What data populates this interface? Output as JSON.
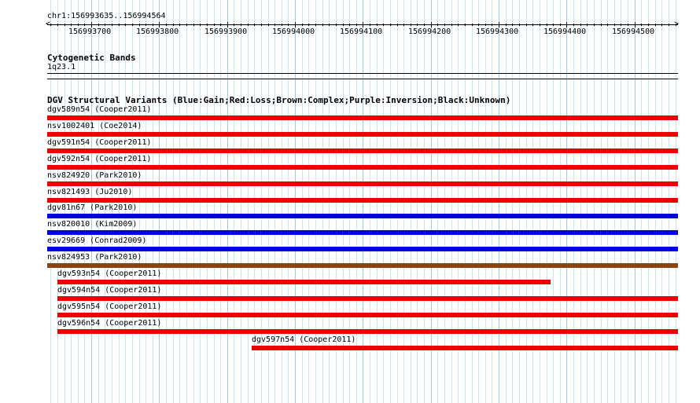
{
  "locus": "chr1:156993635..156994564",
  "ruler": {
    "ticks": [
      "156993700",
      "156993800",
      "156993900",
      "156994000",
      "156994100",
      "156994200",
      "156994300",
      "156994400",
      "156994500"
    ]
  },
  "cytoband": {
    "title": "Cytogenetic Bands",
    "band": "1q23.1"
  },
  "dgv": {
    "title": "DGV Structural Variants (Blue:Gain;Red:Loss;Brown:Complex;Purple:Inversion;Black:Unknown)",
    "colors": {
      "gain": "#0000e0",
      "loss": "#ee0000",
      "complex": "#8b4513"
    },
    "features": [
      {
        "label": "dgv589n54 (Cooper2011)",
        "type": "loss",
        "start": 156993635,
        "end": 156994564
      },
      {
        "label": "nsv1002401 (Coe2014)",
        "type": "loss",
        "start": 156993635,
        "end": 156994564
      },
      {
        "label": "dgv591n54 (Cooper2011)",
        "type": "loss",
        "start": 156993635,
        "end": 156994564
      },
      {
        "label": "dgv592n54 (Cooper2011)",
        "type": "loss",
        "start": 156993635,
        "end": 156994564
      },
      {
        "label": "nsv824920 (Park2010)",
        "type": "loss",
        "start": 156993635,
        "end": 156994564
      },
      {
        "label": "nsv821493 (Ju2010)",
        "type": "loss",
        "start": 156993635,
        "end": 156994564
      },
      {
        "label": "dgv81n67 (Park2010)",
        "type": "gain",
        "start": 156993635,
        "end": 156994564
      },
      {
        "label": "nsv820010 (Kim2009)",
        "type": "gain",
        "start": 156993635,
        "end": 156994564
      },
      {
        "label": "esv29669 (Conrad2009)",
        "type": "gain",
        "start": 156993635,
        "end": 156994564
      },
      {
        "label": "nsv824953 (Park2010)",
        "type": "complex",
        "start": 156993635,
        "end": 156994564
      },
      {
        "label": "dgv593n54 (Cooper2011)",
        "type": "loss",
        "start": 156993650,
        "end": 156994376
      },
      {
        "label": "dgv594n54 (Cooper2011)",
        "type": "loss",
        "start": 156993650,
        "end": 156994564
      },
      {
        "label": "dgv595n54 (Cooper2011)",
        "type": "loss",
        "start": 156993650,
        "end": 156994564
      },
      {
        "label": "dgv596n54 (Cooper2011)",
        "type": "loss",
        "start": 156993650,
        "end": 156994564
      },
      {
        "label": "dgv597n54 (Cooper2011)",
        "type": "loss",
        "start": 156993936,
        "end": 156994564
      }
    ]
  }
}
